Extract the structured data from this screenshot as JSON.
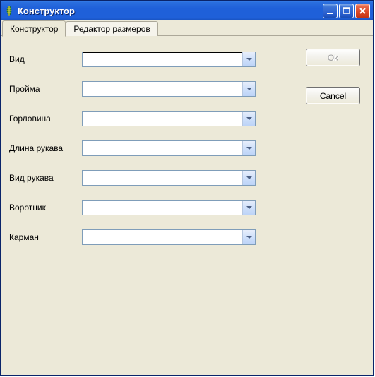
{
  "window": {
    "title": "Конструктор"
  },
  "tabs": [
    {
      "label": "Конструктор",
      "active": true
    },
    {
      "label": "Редактор размеров",
      "active": false
    }
  ],
  "form": {
    "fields": [
      {
        "label": "Вид",
        "value": ""
      },
      {
        "label": "Пройма",
        "value": ""
      },
      {
        "label": "Горловина",
        "value": ""
      },
      {
        "label": "Длина рукава",
        "value": ""
      },
      {
        "label": "Вид рукава",
        "value": ""
      },
      {
        "label": "Воротник",
        "value": ""
      },
      {
        "label": "Карман",
        "value": ""
      }
    ]
  },
  "buttons": {
    "ok": "Ok",
    "cancel": "Cancel"
  }
}
